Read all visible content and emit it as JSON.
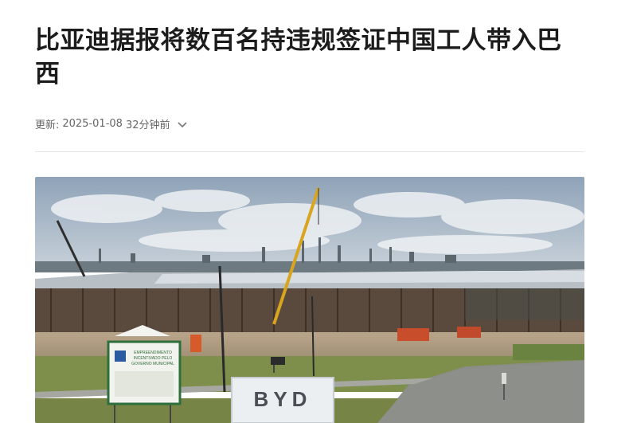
{
  "article": {
    "title": "比亚迪据报将数百名持违规签证中国工人带入巴西",
    "updated_label": "更新:",
    "updated_date": "2025-01-08",
    "updated_relative": "32分钟前",
    "expand_icon": "chevron-down-icon"
  },
  "photo": {
    "sign_text_lines": [
      "EMPREENDIMENTO",
      "INCENTIVADO PELO",
      "GOVERNO MUNICIPAL"
    ],
    "logo_text": "BYD"
  },
  "colors": {
    "text": "#1c1c1c",
    "meta": "#666666",
    "divider": "#e6e6e6",
    "sky": "#a9b8c6",
    "grass": "#6f8a3e",
    "crane": "#d9a41e"
  }
}
